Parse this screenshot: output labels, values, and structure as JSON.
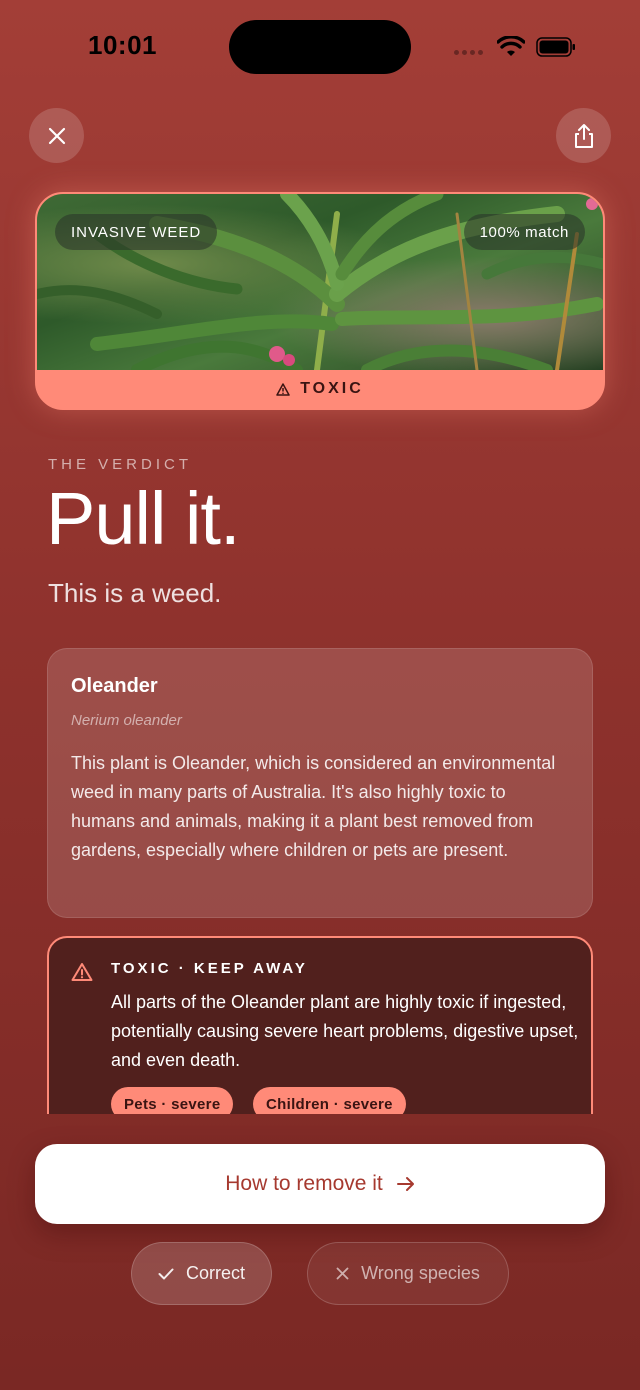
{
  "status_bar": {
    "time": "10:01",
    "icons": [
      "signal-icon",
      "wifi-icon",
      "battery-icon"
    ]
  },
  "header": {
    "close_icon": "close-icon",
    "share_icon": "share-icon"
  },
  "photo_card": {
    "weed_label": "INVASIVE WEED",
    "match_label": "100% match",
    "toxic_label": "TOXIC",
    "toxic_icon": "warning-icon"
  },
  "verdict": {
    "label": "THE VERDICT",
    "title": "Pull it.",
    "subtitle": "This is a weed."
  },
  "plant": {
    "name": "Oleander",
    "latin": "Nerium oleander",
    "description": "This plant is Oleander, which is considered an environmental weed in many parts of Australia. It's also highly toxic to humans and animals, making it a plant best removed from gardens, especially where children or pets are present."
  },
  "warning": {
    "title": "TOXIC · KEEP AWAY",
    "text": "All parts of the Oleander plant are highly toxic if ingested, potentially causing severe heart problems, digestive upset, and even death.",
    "tags": [
      "Pets · severe",
      "Children · severe"
    ]
  },
  "actions": {
    "primary_label": "How to remove it",
    "correct_label": "Correct",
    "wrong_label": "Wrong species"
  },
  "colors": {
    "background": "#9b3a33",
    "accent": "#ff8a78",
    "warning_card": "#51201d",
    "primary_text": "#a6392f"
  }
}
